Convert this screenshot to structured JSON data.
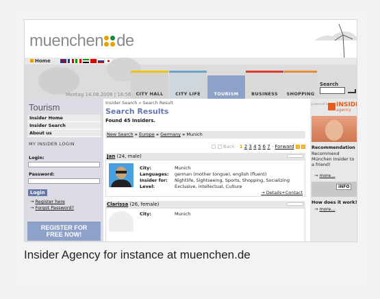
{
  "site": {
    "logo_main": "muenchen",
    "logo_tld": "de",
    "home_label": "Home",
    "date_text": "Montag 14.08.2006 | 16:56",
    "search_label": "Search"
  },
  "nav_tabs": [
    {
      "label": "CITY HALL",
      "color": "#f0c400"
    },
    {
      "label": "CITY LIFE",
      "color": "#6aa2c8"
    },
    {
      "label": "TOURISM",
      "color": "#8ea1c9"
    },
    {
      "label": "BUSINESS",
      "color": "#d63a2f"
    },
    {
      "label": "SHOPPING",
      "color": "#e88a3a"
    }
  ],
  "left": {
    "title": "Tourism",
    "menu": [
      "Insider Home",
      "Insider Search",
      "About us"
    ],
    "insider_login": "MY INSIDER LOGIN",
    "login_label": "Login:",
    "password_label": "Password:",
    "login_button": "Login",
    "register_link": "Register here",
    "forgot_link": "Forgot Password?",
    "register_now_line1": "REGISTER FOR",
    "register_now_line2": "FREE NOW!"
  },
  "main": {
    "breadcrumb": "Insider Search  »  Search Result",
    "title": "Search Results",
    "found": "Found 45 Insiders.",
    "path": {
      "new_search": "New Search",
      "europe": "Europe",
      "germany": "Germany",
      "city": "Munich"
    },
    "pager": {
      "back": "Back",
      "pages": [
        "1",
        "2",
        "3",
        "4",
        "5",
        "6",
        "7"
      ],
      "forward": "Forward"
    },
    "profiles": [
      {
        "name": "Jan",
        "meta": "(24, male)",
        "fields": [
          {
            "k": "City:",
            "v": "Munich"
          },
          {
            "k": "Languages:",
            "v": "german (mother tongue), english (fluent)"
          },
          {
            "k": "Insider for:",
            "v": "Nightlife, Sightseeing, Sports, Shopping, Socializing"
          },
          {
            "k": "Level:",
            "v": "Exclusive, intellectual, Culture"
          }
        ],
        "details_link": "Details+Contact"
      },
      {
        "name": "Clarissa",
        "meta": "(26, female)",
        "fields": [
          {
            "k": "City:",
            "v": "Munich"
          }
        ]
      }
    ]
  },
  "right": {
    "powered_by": "powered by",
    "brand_insider": "INSIDER",
    "brand_agency": "agency",
    "rec_heading": "Recommendation",
    "rec_text": "Recommend München Insider to a friend!",
    "more1": "more...",
    "info_tag": "INFO",
    "how_heading": "How does it work?",
    "more2": "more..."
  },
  "caption": "Insider Agency for instance at muenchen.de"
}
